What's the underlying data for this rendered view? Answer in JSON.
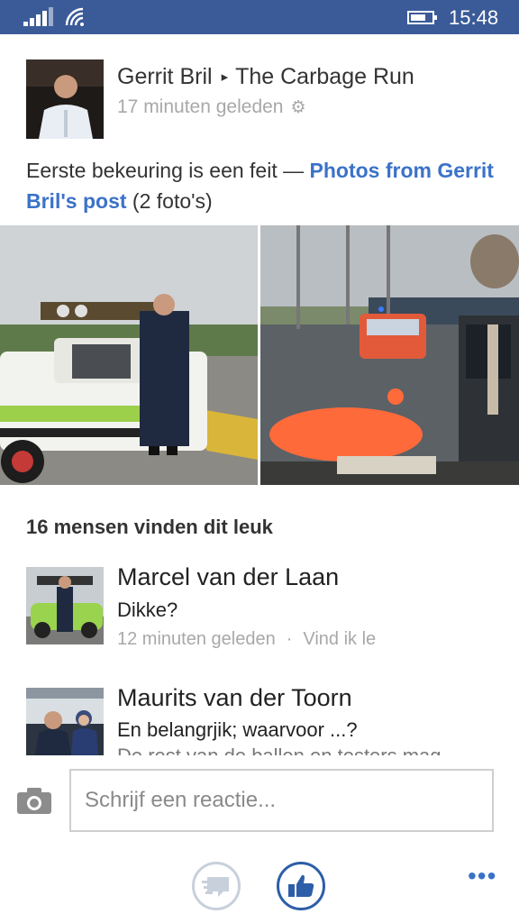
{
  "status_bar": {
    "time": "15:48"
  },
  "post": {
    "author": "Gerrit Bril",
    "arrow": "▸",
    "group": "The Carbage Run",
    "time": "17 minuten geleden",
    "text_main": "Eerste bekeuring is een feit — ",
    "text_link": "Photos from Gerrit Bril's post",
    "text_tail": " (2 foto's)"
  },
  "likes": {
    "text": "16 mensen vinden dit leuk"
  },
  "comments": [
    {
      "name": "Marcel van der Laan",
      "text": "Dikke?",
      "time": "12 minuten geleden",
      "action": "Vind ik le"
    },
    {
      "name": "Maurits van der Toorn",
      "text": "En belangrjik; waarvoor ...?",
      "text_cut": "De rest van de ballen en testers mag"
    }
  ],
  "composer": {
    "placeholder": "Schrijf een reactie..."
  },
  "colors": {
    "status_bar": "#3b5b98",
    "link": "#3b72c9",
    "muted": "#a8a8a8"
  },
  "icons": [
    "signal-icon",
    "wifi-icon",
    "battery-icon",
    "gear-icon",
    "camera-icon",
    "messages-icon",
    "like-icon",
    "more-icon"
  ]
}
